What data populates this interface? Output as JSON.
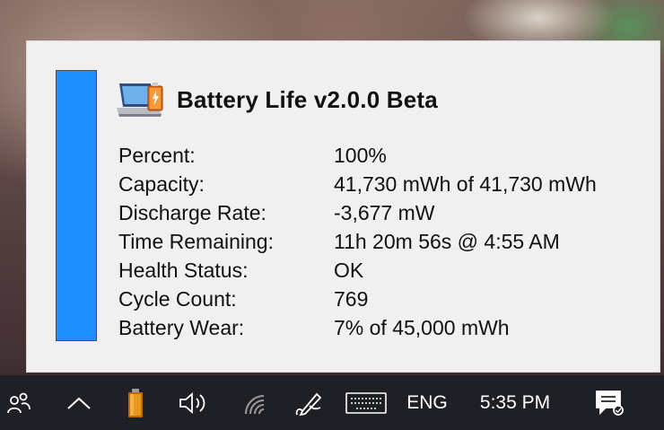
{
  "app": {
    "title": "Battery Life v2.0.0 Beta",
    "icon": "laptop-battery-icon"
  },
  "battery_level": 1.0,
  "colors": {
    "bar_fill": "#1e90ff",
    "popup_bg": "#f0f0f0",
    "taskbar_bg": "#1f2026"
  },
  "rows": [
    {
      "label": "Percent:",
      "value": "100%"
    },
    {
      "label": "Capacity:",
      "value": "41,730 mWh of 41,730 mWh"
    },
    {
      "label": "Discharge Rate:",
      "value": "-3,677 mW"
    },
    {
      "label": "Time Remaining:",
      "value": "11h 20m 56s @ 4:55 AM"
    },
    {
      "label": "Health Status:",
      "value": "OK"
    },
    {
      "label": "Cycle Count:",
      "value": "769"
    },
    {
      "label": "Battery Wear:",
      "value": "7% of 45,000 mWh"
    }
  ],
  "taskbar": {
    "icons": [
      "people-icon",
      "chevron-up-icon",
      "battery-icon",
      "speaker-icon",
      "wifi-icon",
      "pen-icon",
      "keyboard-icon",
      "notification-icon"
    ],
    "language": "ENG",
    "time": "5:35 PM"
  }
}
